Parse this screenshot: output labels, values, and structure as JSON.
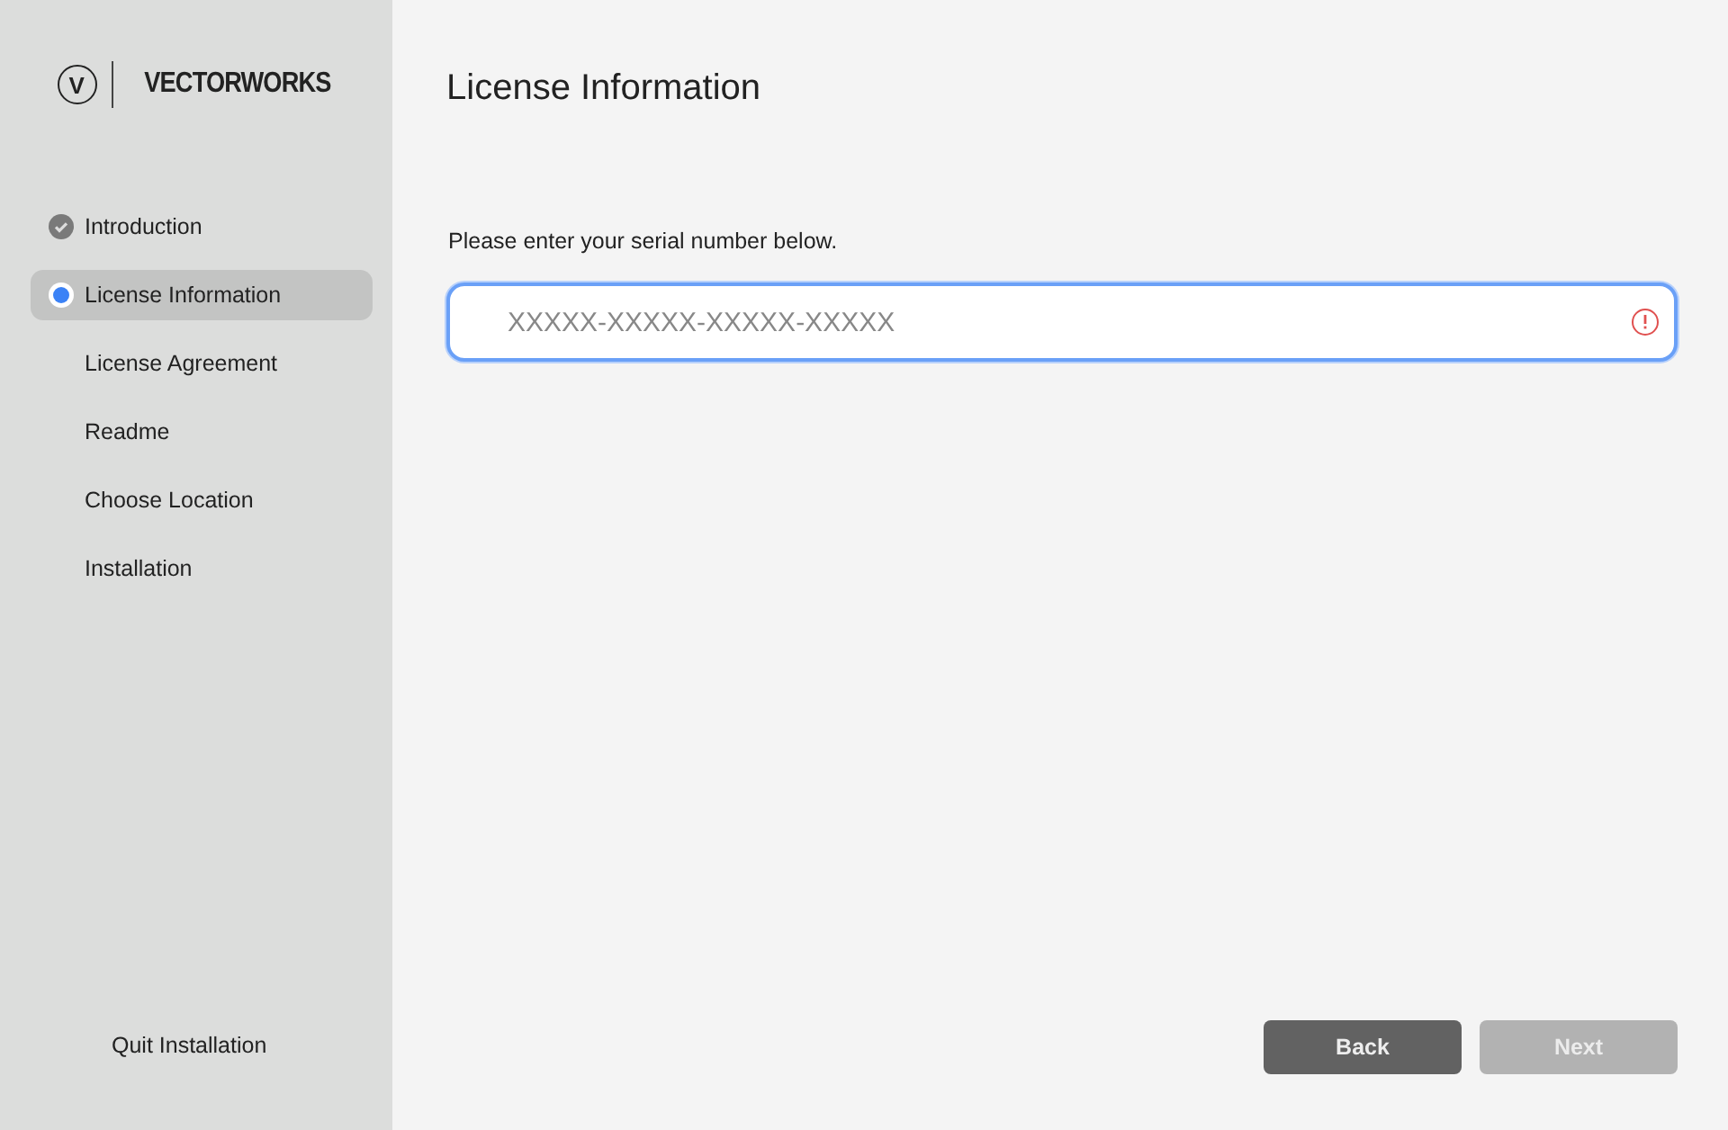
{
  "sidebar": {
    "logo": {
      "mark": "V",
      "name": "VECTORWORKS"
    },
    "steps": [
      {
        "label": "Introduction",
        "completed": true,
        "selected": false
      },
      {
        "label": "License Information",
        "completed": false,
        "selected": true
      },
      {
        "label": "License Agreement",
        "completed": false,
        "selected": false
      },
      {
        "label": "Readme",
        "completed": false,
        "selected": false
      },
      {
        "label": "Choose Location",
        "completed": false,
        "selected": false
      },
      {
        "label": "Installation",
        "completed": false,
        "selected": false
      }
    ],
    "quit": "Quit Installation"
  },
  "main": {
    "title": "License Information",
    "prompt": "Please enter your serial number below.",
    "serial_field": {
      "placeholder": "XXXXX-XXXXX-XXXXX-XXXXX",
      "invalid": true
    },
    "buttons": [
      {
        "label": "Back",
        "disabled": false
      },
      {
        "label": "Next",
        "disabled": true
      }
    ]
  }
}
